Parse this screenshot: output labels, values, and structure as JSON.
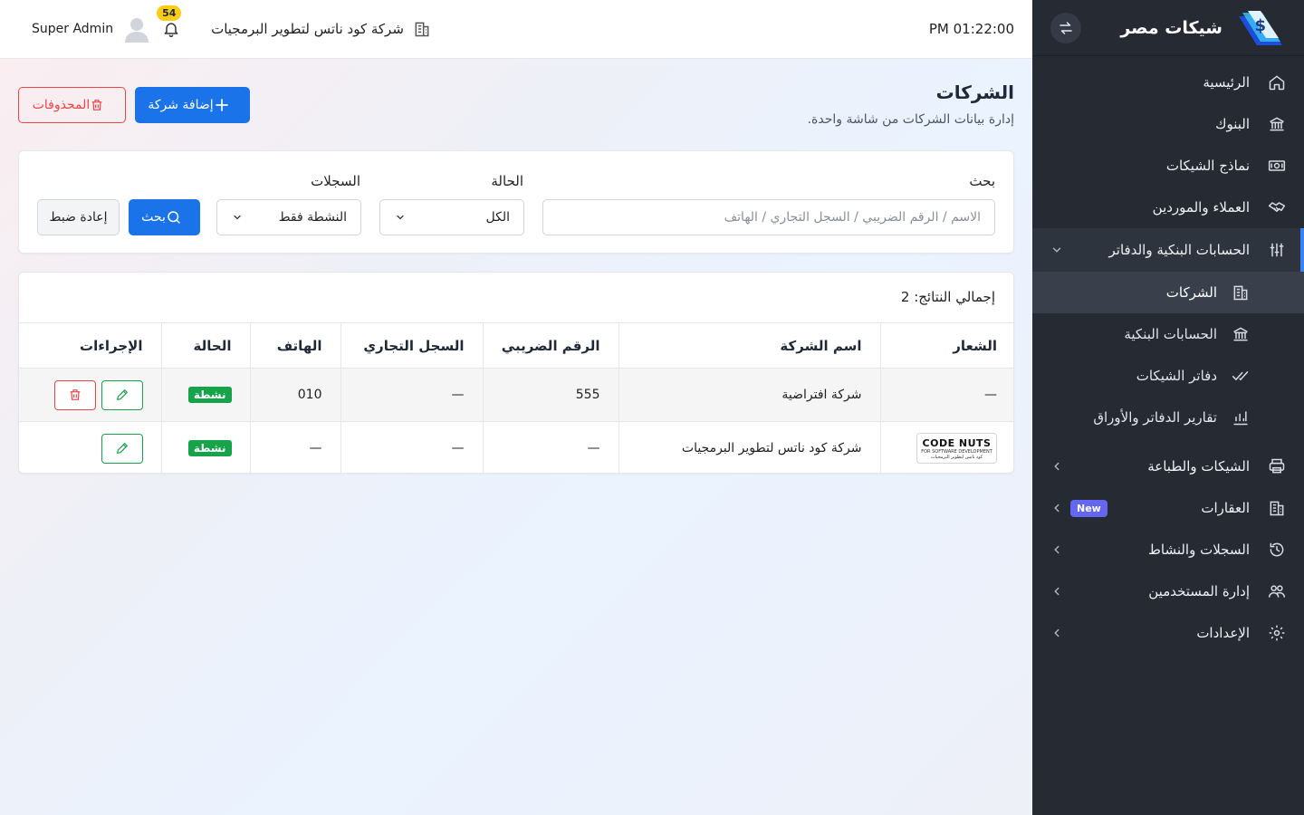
{
  "brand": {
    "name": "شيكات مصر"
  },
  "sidebar": {
    "items": [
      {
        "label": "الرئيسية",
        "icon": "home-icon"
      },
      {
        "label": "البنوك",
        "icon": "bank-icon"
      },
      {
        "label": "نماذج الشيكات",
        "icon": "money-icon"
      },
      {
        "label": "العملاء والموردين",
        "icon": "handshake-icon"
      },
      {
        "label": "الحسابات البنكية والدفاتر",
        "icon": "sliders-icon",
        "expanded": true
      },
      {
        "label": "الشيكات والطباعة",
        "icon": "printer-icon"
      },
      {
        "label": "العقارات",
        "icon": "building-icon",
        "badge": "New"
      },
      {
        "label": "السجلات والنشاط",
        "icon": "history-icon"
      },
      {
        "label": "إدارة المستخدمين",
        "icon": "users-icon"
      },
      {
        "label": "الإعدادات",
        "icon": "gear-icon"
      }
    ],
    "subitems": [
      {
        "label": "الشركات",
        "icon": "building-icon",
        "active": true
      },
      {
        "label": "الحسابات البنكية",
        "icon": "bank-icon"
      },
      {
        "label": "دفاتر الشيكات",
        "icon": "double-check-icon"
      },
      {
        "label": "تقارير الدفاتر والأوراق",
        "icon": "bar-chart-icon"
      }
    ]
  },
  "topbar": {
    "time": "PM 01:22:00",
    "company": "شركة كود ناتس لتطوير البرمجيات",
    "notifications": "54",
    "user": "Super Admin"
  },
  "page": {
    "title": "الشركات",
    "subtitle": "إدارة بيانات الشركات من شاشة واحدة.",
    "add_button": "إضافة شركة",
    "deleted_button": "المحذوفات"
  },
  "filters": {
    "search_label": "بحث",
    "search_placeholder": "الاسم / الرقم الضريبي / السجل التجاري / الهاتف",
    "status_label": "الحالة",
    "status_value": "الكل",
    "records_label": "السجلات",
    "records_value": "النشطة فقط",
    "search_button": "بحث",
    "reset_button": "إعادة ضبط"
  },
  "results": {
    "total": "إجمالي النتائج: 2",
    "columns": [
      "الشعار",
      "اسم الشركة",
      "الرقم الضريبي",
      "السجل التجاري",
      "الهاتف",
      "الحالة",
      "الإجراءات"
    ],
    "rows": [
      {
        "logo": "—",
        "name": "شركة افتراضية",
        "tax": "555",
        "cr": "—",
        "phone": "010",
        "status": "نشطة"
      },
      {
        "logo_title": "CODE NUTS",
        "logo_sub": "FOR SOFTWARE DEVELOPMENT",
        "logo_ar": "كود ناتس لتطوير البرمجيات",
        "name": "شركة كود ناتس لتطوير البرمجيات",
        "tax": "—",
        "cr": "—",
        "phone": "—",
        "status": "نشطة"
      }
    ]
  },
  "colors": {
    "primary": "#1a73e8",
    "danger": "#ef4444",
    "success": "#16a34a",
    "sidebar": "#252a33"
  }
}
